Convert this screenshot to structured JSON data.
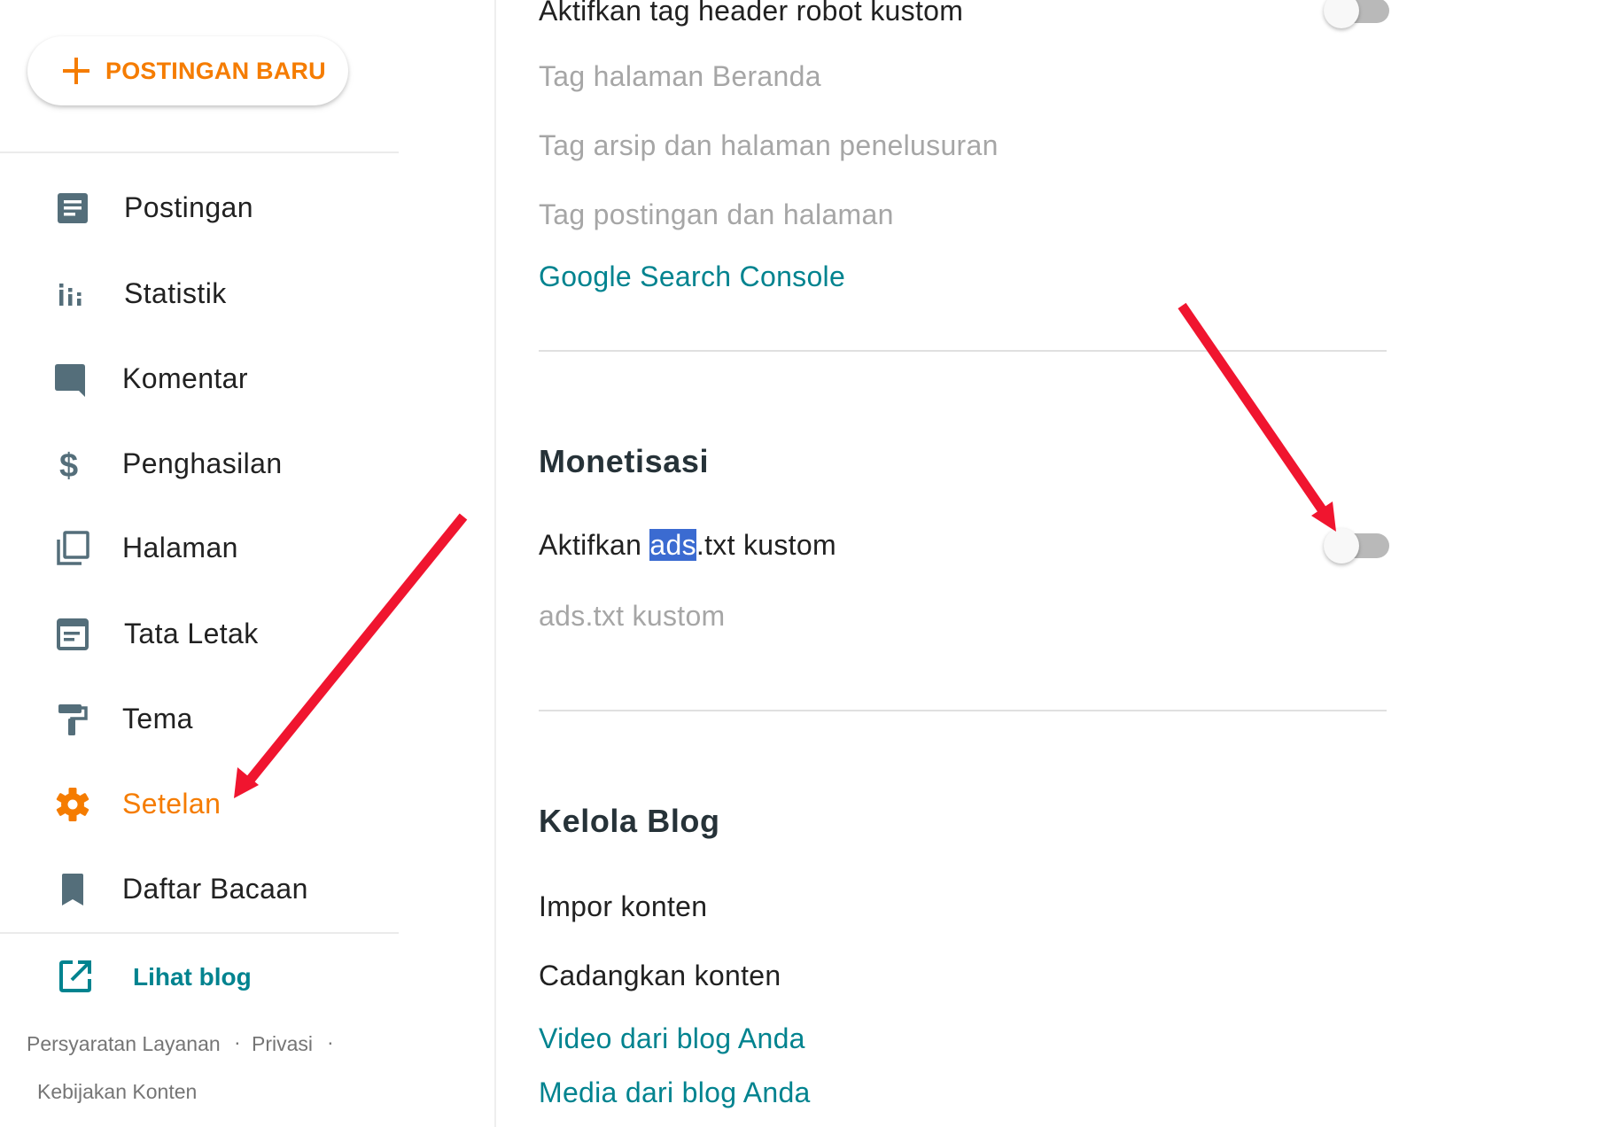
{
  "sidebar": {
    "new_post_label": "POSTINGAN BARU",
    "nav_items": [
      {
        "label": "Postingan",
        "icon": "posts-icon"
      },
      {
        "label": "Statistik",
        "icon": "stats-icon"
      },
      {
        "label": "Komentar",
        "icon": "comment-icon"
      },
      {
        "label": "Penghasilan",
        "icon": "dollar-icon"
      },
      {
        "label": "Halaman",
        "icon": "pages-icon"
      },
      {
        "label": "Tata Letak",
        "icon": "layout-icon"
      },
      {
        "label": "Tema",
        "icon": "paint-roller-icon"
      },
      {
        "label": "Setelan",
        "icon": "gear-icon",
        "active": true
      },
      {
        "label": "Daftar Bacaan",
        "icon": "bookmark-icon"
      }
    ],
    "view_blog_label": "Lihat blog",
    "footer": {
      "terms": "Persyaratan Layanan",
      "privacy": "Privasi",
      "separator": "·",
      "content_policy": "Kebijakan Konten"
    }
  },
  "content": {
    "crawlers": {
      "robot_header_toggle_label": "Aktifkan tag header robot kustom",
      "robot_header_enabled": false,
      "home_page_tags": "Tag halaman Beranda",
      "archive_search_tags": "Tag arsip dan halaman penelusuran",
      "post_page_tags": "Tag postingan dan halaman",
      "search_console_link": "Google Search Console"
    },
    "monetization": {
      "heading": "Monetisasi",
      "custom_ads_toggle_label_prefix": "Aktifkan ",
      "custom_ads_toggle_label_highlight": "ads",
      "custom_ads_toggle_label_suffix": ".txt kustom",
      "custom_ads_enabled": false,
      "custom_ads_field": "ads.txt kustom"
    },
    "manage_blog": {
      "heading": "Kelola Blog",
      "import_content": "Impor konten",
      "backup_content": "Cadangkan konten",
      "videos_link": "Video dari blog Anda",
      "media_link": "Media dari blog Anda"
    }
  },
  "colors": {
    "accent_orange": "#f57c00",
    "link_teal": "#00838f",
    "icon_slate": "#546e7a",
    "annotation_red": "#f0152f",
    "selection_blue": "#3b6bd1"
  }
}
